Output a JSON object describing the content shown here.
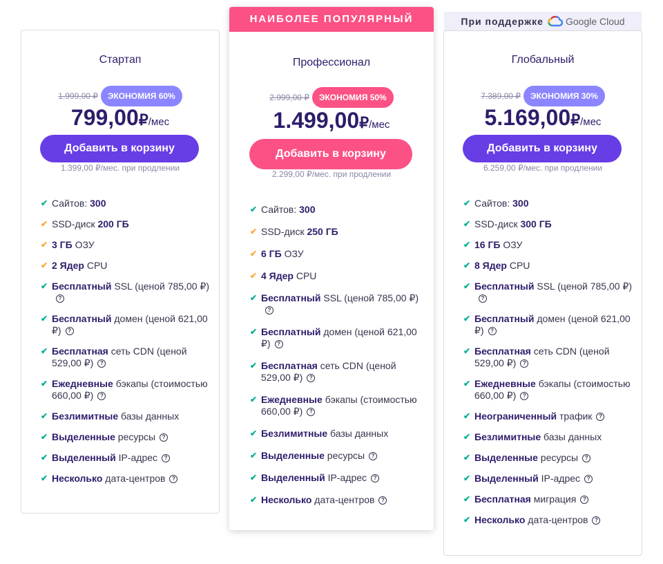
{
  "popular_label": "НАИБОЛЕЕ ПОПУЛЯРНЫЙ",
  "powered_by": {
    "label": "При поддержке",
    "brand": "Google Cloud"
  },
  "plans": [
    {
      "name": "Стартап",
      "old_price": "1.999,00 ₽",
      "discount": "ЭКОНОМИЯ 60%",
      "price": "799,00",
      "currency": "₽",
      "unit": "/мес",
      "button": "Добавить в корзину",
      "renewal": "1.399,00 ₽/мес. при продлении",
      "features": [
        {
          "bold": "",
          "pre": "Сайтов: ",
          "strong": "300",
          "post": "",
          "color": "green",
          "help": false
        },
        {
          "pre": "SSD-диск ",
          "strong": "200 ГБ",
          "post": "",
          "color": "orange",
          "help": false
        },
        {
          "pre": "",
          "strong": "3 ГБ",
          "post": " ОЗУ",
          "color": "orange",
          "help": false
        },
        {
          "pre": "",
          "strong": "2 Ядер",
          "post": " CPU",
          "color": "orange",
          "help": false
        },
        {
          "pre": "",
          "strong": "Бесплатный",
          "post": " SSL (ценой 785,00 ₽)",
          "color": "green",
          "help": true
        },
        {
          "pre": "",
          "strong": "Бесплатный",
          "post": " домен (ценой 621,00 ₽)",
          "color": "green",
          "help": true
        },
        {
          "pre": "",
          "strong": "Бесплатная",
          "post": " сеть CDN (ценой 529,00 ₽)",
          "color": "green",
          "help": true
        },
        {
          "pre": "",
          "strong": "Ежедневные",
          "post": " бэкапы (стоимостью 660,00 ₽)",
          "color": "green",
          "help": true
        },
        {
          "pre": "",
          "strong": "Безлимитные",
          "post": " базы данных",
          "color": "green",
          "help": false
        },
        {
          "pre": "",
          "strong": "Выделенные",
          "post": " ресурсы",
          "color": "green",
          "help": true
        },
        {
          "pre": "",
          "strong": "Выделенный",
          "post": " IP-адрес",
          "color": "green",
          "help": true
        },
        {
          "pre": "",
          "strong": "Несколько",
          "post": " дата-центров",
          "color": "green",
          "help": true
        }
      ]
    },
    {
      "name": "Профессионал",
      "old_price": "2.999,00 ₽",
      "discount": "ЭКОНОМИЯ 50%",
      "price": "1.499,00",
      "currency": "₽",
      "unit": "/мес",
      "button": "Добавить в корзину",
      "renewal": "2.299,00 ₽/мес. при продлении",
      "features": [
        {
          "pre": "Сайтов: ",
          "strong": "300",
          "post": "",
          "color": "green",
          "help": false
        },
        {
          "pre": "SSD-диск ",
          "strong": "250 ГБ",
          "post": "",
          "color": "orange",
          "help": false
        },
        {
          "pre": "",
          "strong": "6 ГБ",
          "post": " ОЗУ",
          "color": "orange",
          "help": false
        },
        {
          "pre": "",
          "strong": "4 Ядер",
          "post": " CPU",
          "color": "orange",
          "help": false
        },
        {
          "pre": "",
          "strong": "Бесплатный",
          "post": " SSL (ценой 785,00 ₽)",
          "color": "green",
          "help": true
        },
        {
          "pre": "",
          "strong": "Бесплатный",
          "post": " домен (ценой 621,00 ₽)",
          "color": "green",
          "help": true
        },
        {
          "pre": "",
          "strong": "Бесплатная",
          "post": " сеть CDN (ценой 529,00 ₽)",
          "color": "green",
          "help": true
        },
        {
          "pre": "",
          "strong": "Ежедневные",
          "post": " бэкапы (стоимостью 660,00 ₽)",
          "color": "green",
          "help": true
        },
        {
          "pre": "",
          "strong": "Безлимитные",
          "post": " базы данных",
          "color": "green",
          "help": false
        },
        {
          "pre": "",
          "strong": "Выделенные",
          "post": " ресурсы",
          "color": "green",
          "help": true
        },
        {
          "pre": "",
          "strong": "Выделенный",
          "post": " IP-адрес",
          "color": "green",
          "help": true
        },
        {
          "pre": "",
          "strong": "Несколько",
          "post": " дата-центров",
          "color": "green",
          "help": true
        }
      ]
    },
    {
      "name": "Глобальный",
      "old_price": "7.389,00 ₽",
      "discount": "ЭКОНОМИЯ 30%",
      "price": "5.169,00",
      "currency": "₽",
      "unit": "/мес",
      "button": "Добавить в корзину",
      "renewal": "6.259,00 ₽/мес. при продлении",
      "features": [
        {
          "pre": "Сайтов: ",
          "strong": "300",
          "post": "",
          "color": "green",
          "help": false
        },
        {
          "pre": "SSD-диск ",
          "strong": "300 ГБ",
          "post": "",
          "color": "green",
          "help": false
        },
        {
          "pre": "",
          "strong": "16 ГБ",
          "post": " ОЗУ",
          "color": "green",
          "help": false
        },
        {
          "pre": "",
          "strong": "8 Ядер",
          "post": " CPU",
          "color": "green",
          "help": false
        },
        {
          "pre": "",
          "strong": "Бесплатный",
          "post": " SSL (ценой 785,00 ₽)",
          "color": "green",
          "help": true
        },
        {
          "pre": "",
          "strong": "Бесплатный",
          "post": " домен (ценой 621,00 ₽)",
          "color": "green",
          "help": true
        },
        {
          "pre": "",
          "strong": "Бесплатная",
          "post": " сеть CDN (ценой 529,00 ₽)",
          "color": "green",
          "help": true
        },
        {
          "pre": "",
          "strong": "Ежедневные",
          "post": " бэкапы (стоимостью 660,00 ₽)",
          "color": "green",
          "help": true
        },
        {
          "pre": "",
          "strong": "Неограниченный",
          "post": " трафик",
          "color": "green",
          "help": true
        },
        {
          "pre": "",
          "strong": "Безлимитные",
          "post": " базы данных",
          "color": "green",
          "help": false
        },
        {
          "pre": "",
          "strong": "Выделенные",
          "post": " ресурсы",
          "color": "green",
          "help": true
        },
        {
          "pre": "",
          "strong": "Выделенный",
          "post": " IP-адрес",
          "color": "green",
          "help": true
        },
        {
          "pre": "",
          "strong": "Бесплатная",
          "post": " миграция",
          "color": "green",
          "help": true
        },
        {
          "pre": "",
          "strong": "Несколько",
          "post": " дата-центров",
          "color": "green",
          "help": true
        }
      ]
    }
  ],
  "colors": {
    "accent": "#673de6",
    "pink": "#fc5185",
    "check_green": "#00b090",
    "check_orange": "#ffa534"
  }
}
